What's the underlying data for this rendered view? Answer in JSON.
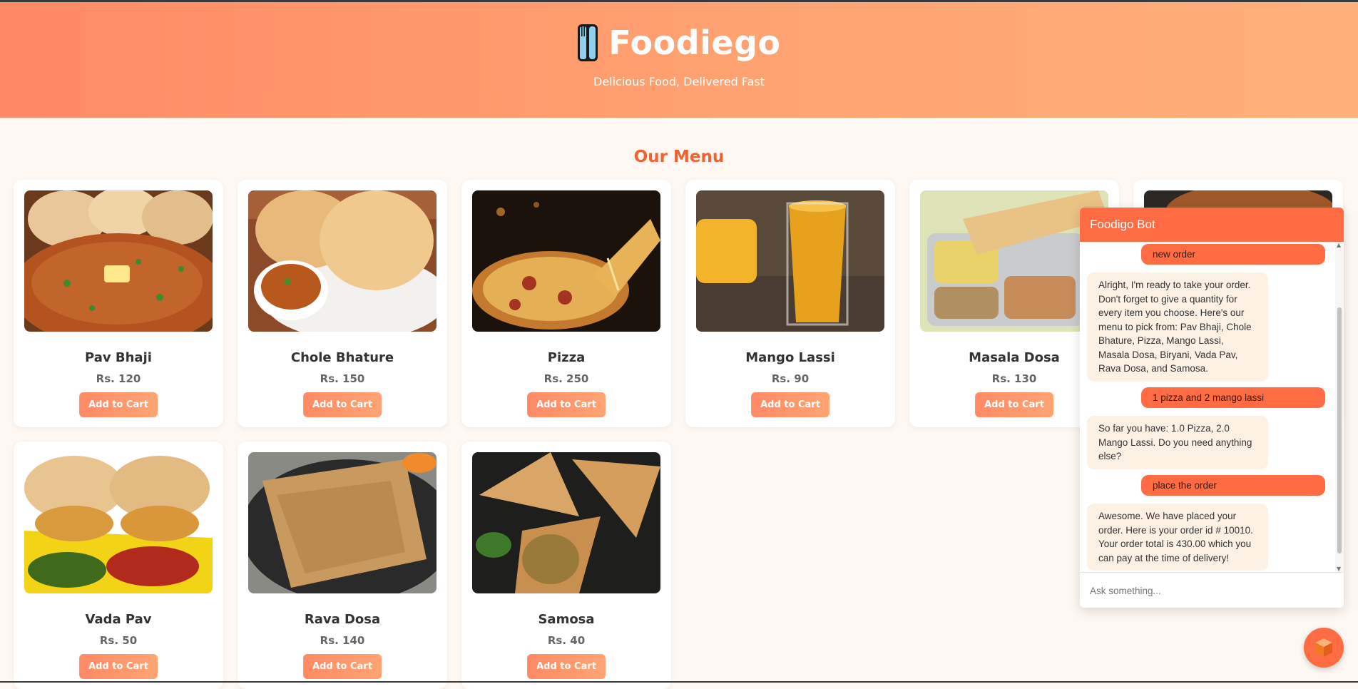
{
  "header": {
    "title": "Foodiego",
    "tagline": "Delicious Food, Delivered Fast",
    "icon": "fork-knife-icon"
  },
  "menu": {
    "title": "Our Menu",
    "button_label": "Add to Cart",
    "items": [
      {
        "name": "Pav Bhaji",
        "price": "Rs. 120"
      },
      {
        "name": "Chole Bhature",
        "price": "Rs. 150"
      },
      {
        "name": "Pizza",
        "price": "Rs. 250"
      },
      {
        "name": "Mango Lassi",
        "price": "Rs. 90"
      },
      {
        "name": "Masala Dosa",
        "price": "Rs. 130"
      },
      {
        "name": "Vada Pav",
        "price": "Rs. 50"
      },
      {
        "name": "Rava Dosa",
        "price": "Rs. 140"
      },
      {
        "name": "Samosa",
        "price": "Rs. 40"
      }
    ]
  },
  "chat": {
    "title": "Foodigo Bot",
    "messages": [
      {
        "from": "user",
        "text": "new order"
      },
      {
        "from": "bot",
        "text": "Alright, I'm ready to take your order. Don't forget to give a quantity for every item you choose. Here's our menu to pick from: Pav Bhaji, Chole Bhature, Pizza, Mango Lassi, Masala Dosa, Biryani, Vada Pav, Rava Dosa, and Samosa."
      },
      {
        "from": "user",
        "text": "1 pizza and 2 mango lassi"
      },
      {
        "from": "bot",
        "text": "So far you have: 1.0 Pizza, 2.0 Mango Lassi. Do you need anything else?"
      },
      {
        "from": "user",
        "text": "place the order"
      },
      {
        "from": "bot",
        "text": "Awesome. We have placed your order. Here is your order id # 10010. Your order total is 430.00 which you can pay at the time of delivery!"
      }
    ],
    "input_placeholder": "Ask something...",
    "fab_icon": "cube-icon"
  },
  "colors": {
    "accent": "#ff6b43",
    "header_start": "#ff8a66",
    "header_end": "#ffb07a",
    "menu_title": "#f06232",
    "page_bg": "#fff8f2",
    "bot_bubble": "#fdf1e4"
  }
}
